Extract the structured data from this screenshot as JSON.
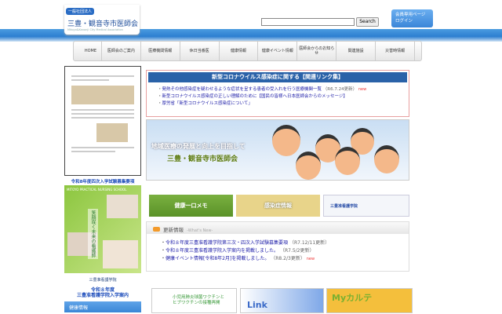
{
  "header": {
    "corp_tag": "一般社団法人",
    "org_name": "三豊・観音寺市医師会",
    "org_name_en": "Mitoyo&Kanonji City Medical Association",
    "search_placeholder": "",
    "search_button": "Search",
    "login": [
      "会員専用ページ",
      "ログイン"
    ]
  },
  "nav": [
    "HOME",
    "医師会のご案内",
    "医療機関情報",
    "休日当番医",
    "健康情報",
    "健康イベント情報",
    "医師会からのお知らせ",
    "関連施設",
    "災害時情報"
  ],
  "left": {
    "exam_title": "令和8年度四次入学試験募集要項",
    "school_en": "MITOYO PRACTICAL NURSING SCHOOL",
    "vertical_text": "笑顔咲く未来の看護師",
    "school_name": "三豊准看護学院",
    "admission": [
      "令和８年度",
      "三豊准看護学院入学案内"
    ],
    "health": "健康情報"
  },
  "corona": {
    "title": "新型コロナウイルス感染症に関する【関連リンク集】",
    "items": [
      {
        "text": "発熱その他感染症を疑わせるような症状を呈する患者の受入れを行う医療機関一覧",
        "date": "（R6.7.24更新）",
        "new": "new"
      },
      {
        "text": "新型コロナウイルス感染症の正しい理解のために【国民の皆様へ日本医師会からのメッセージ】"
      },
      {
        "text": "厚労省「新型コロナウイルス感染症について」"
      }
    ]
  },
  "hero": {
    "line1": "地域医療の発展と向上を目指して",
    "line2": "三豊・観音寺市医師会"
  },
  "banners": {
    "memo": "健康一口メモ",
    "infection": "感染症情報",
    "nursing": "三豊准看護学院"
  },
  "news": {
    "title": "更新情報",
    "subtitle": "-What's New-",
    "items": [
      {
        "text": "令和８年度三豊准看護学院第三次・四次入学試験募集要項",
        "date": "（R7.12/11更新）"
      },
      {
        "text": "令和８年度三豊准看護学院入学案内を掲載しました。",
        "date": "（R7.5/2更新）"
      },
      {
        "text": "健康イベント情報[令和8年2月]を掲載しました。",
        "date": "（R8.2/3更新）",
        "new": "new"
      }
    ]
  },
  "bottom": {
    "vaccine": [
      "小児用肺炎球菌ワクチンと",
      "ヒブワクチンの接種再開"
    ],
    "link": "Link",
    "karte": "Myカルテ"
  }
}
